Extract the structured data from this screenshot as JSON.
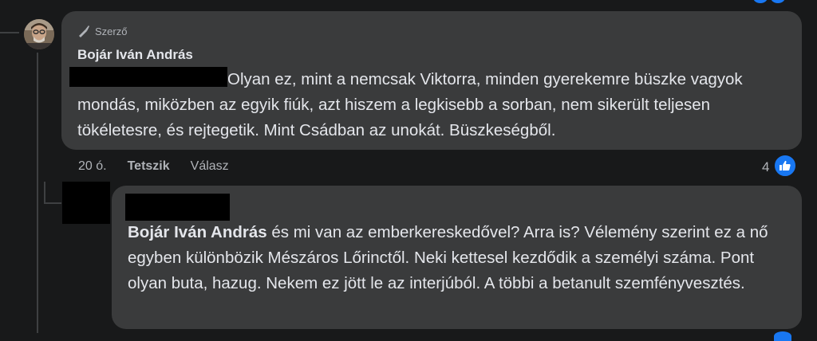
{
  "colors": {
    "background": "#18191a",
    "bubble": "#3a3b3c",
    "text": "#e4e6eb",
    "secondary_text": "#b0b3b8",
    "like_blue": "#1877f2",
    "redaction": "#000000"
  },
  "comment": {
    "badge_icon": "quill-pen-icon",
    "badge_label": "Szerző",
    "author": "Bojár Iván András",
    "text": "Olyan ez, mint a nemcsak Viktorra, minden gyerekemre büszke vagyok mondás, miközben az egyik fiúk, azt hiszem a legkisebb a sorban, nem sikerült teljesen tökéletesre, és rejtegetik. Mint Csádban az unokát. Büszkeségből.",
    "time": "20 ó.",
    "like_label": "Tetszik",
    "reply_label": "Válasz",
    "reaction_count": "4",
    "reaction_icon": "like-thumb-icon"
  },
  "reply": {
    "mention": "Bojár Iván András",
    "text": " és mi van az emberkereskedővel? Arra is? Vélemény szerint ez a nő egyben különbözik Mészáros Lőrinctől. Neki kettesel kezdődik a személyi száma. Pont olyan buta, hazug. Nekem ez jött le az interjúból. A többi a betanult szemfényvesztés."
  }
}
